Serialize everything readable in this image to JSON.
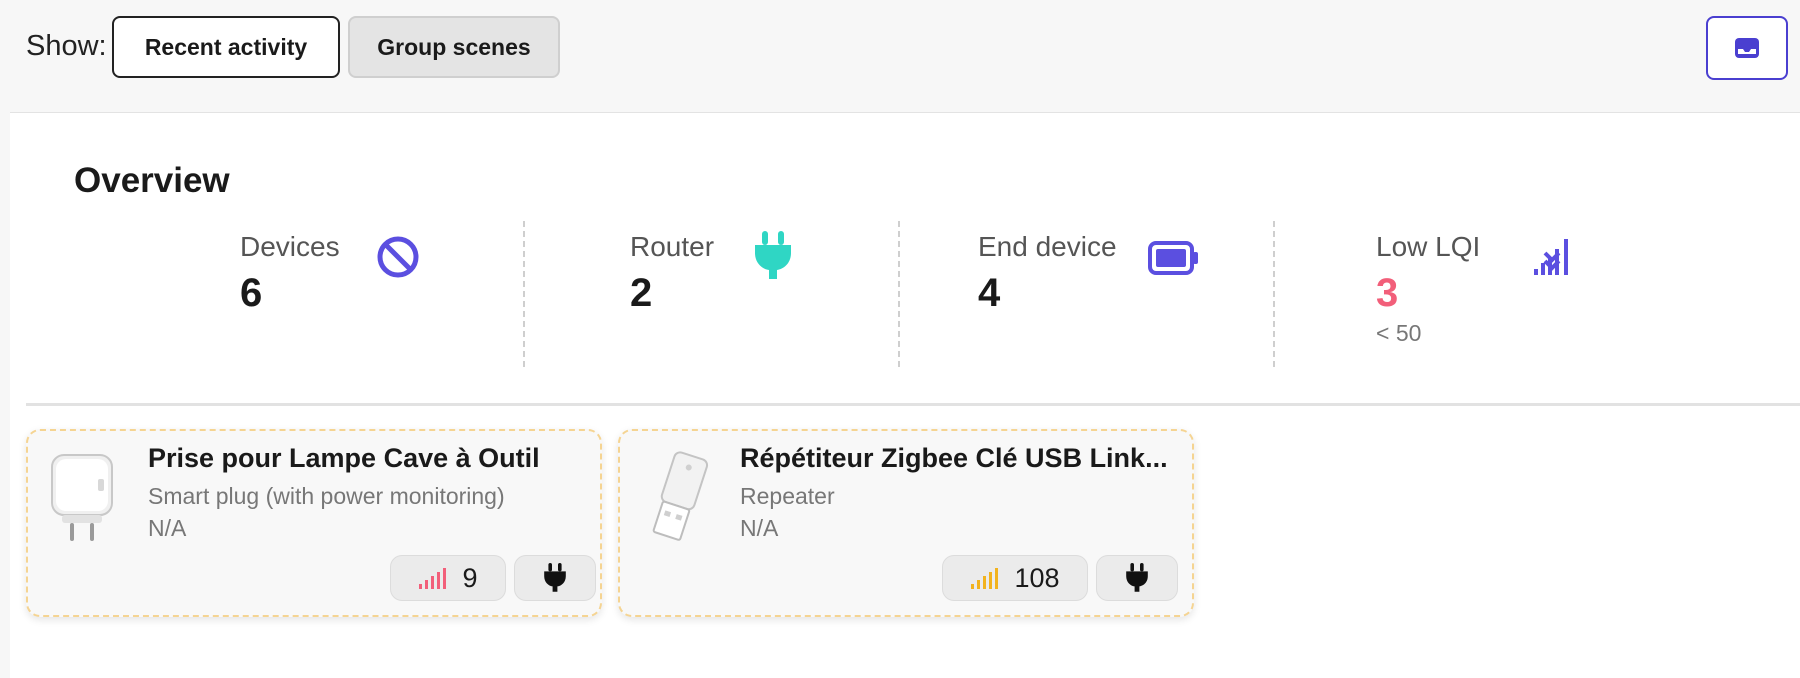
{
  "toolbar": {
    "show_label": "Show:",
    "recent_activity": "Recent activity",
    "group_scenes": "Group scenes",
    "inbox_icon": "inbox-icon"
  },
  "overview": {
    "title": "Overview",
    "stats": [
      {
        "label": "Devices",
        "value": "6",
        "icon": "ban-icon",
        "color": "#5b4fe0"
      },
      {
        "label": "Router",
        "value": "2",
        "icon": "plug-icon",
        "color": "#2fd6c4"
      },
      {
        "label": "End device",
        "value": "4",
        "icon": "battery-icon",
        "color": "#5b4fe0"
      },
      {
        "label": "Low LQI",
        "value": "3",
        "sub": "< 50",
        "icon": "signal-down-icon",
        "color": "#5b4fe0",
        "value_color": "#f25f7a"
      }
    ]
  },
  "devices": [
    {
      "name": "Prise pour Lampe Cave à Outil",
      "model": "Smart plug (with power monitoring)",
      "power": "N/A",
      "lqi": "9",
      "lqi_color": "#f25f7a",
      "power_source_icon": "plug-icon",
      "image_icon": "smart-plug-image"
    },
    {
      "name": "Répétiteur Zigbee Clé USB Link...",
      "model": "Repeater",
      "power": "N/A",
      "lqi": "108",
      "lqi_color": "#f2b31e",
      "power_source_icon": "plug-icon",
      "image_icon": "usb-repeater-image"
    }
  ],
  "colors": {
    "accent": "#4a3fd0",
    "card_border": "#f5d492"
  }
}
